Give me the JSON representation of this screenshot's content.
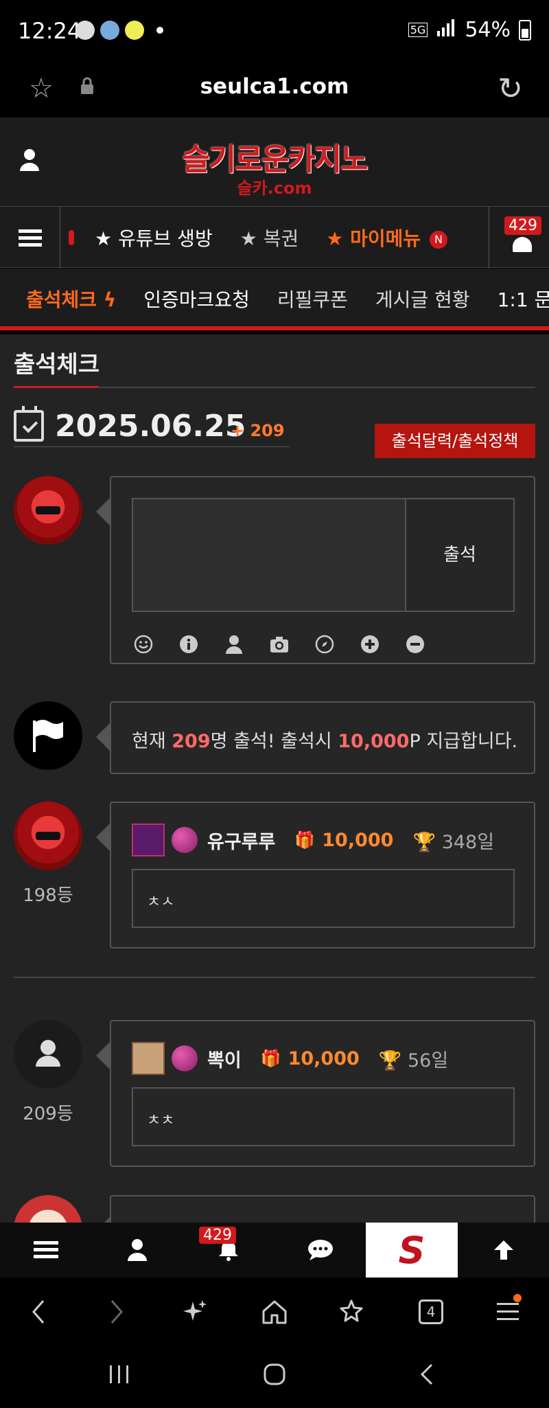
{
  "status_bar": {
    "time": "12:24",
    "network": "5G",
    "battery": "54%"
  },
  "url_bar": {
    "url": "seulca1.com"
  },
  "site": {
    "logo_main": "슬기로운카지노",
    "logo_sub": "슬카.com"
  },
  "nav": {
    "items": [
      {
        "label": "★ 유튜브 생방"
      },
      {
        "label": "★ 복권"
      },
      {
        "label": "★ 마이메뉴"
      }
    ],
    "new_badge": "N",
    "notification_count": "429"
  },
  "subtabs": {
    "items": [
      {
        "label": "출석체크 ϟ"
      },
      {
        "label": "인증마크요청"
      },
      {
        "label": "리필쿠폰"
      },
      {
        "label": "게시글 현황"
      },
      {
        "label": "1:1 문"
      }
    ]
  },
  "attendance": {
    "page_title": "출석체크",
    "date": "2025.06.25",
    "count_delta": "+ 209",
    "policy_button": "출석달력/출석정책",
    "submit_label": "출석",
    "notice": {
      "prefix": "현재 ",
      "count": "209",
      "middle": "명 출석! 출석시 ",
      "amount": "10,000",
      "suffix": "P 지급합니다."
    },
    "entries": [
      {
        "rank": "198등",
        "username": "유구루루",
        "points": "10,000",
        "days": "348일",
        "comment": "ㅊㅅ"
      },
      {
        "rank": "209등",
        "username": "뽁이",
        "points": "10,000",
        "days": "56일",
        "comment": "ㅊㅊ"
      }
    ]
  },
  "app_bar": {
    "notification_count": "429",
    "logo_letter": "S"
  },
  "browser_bar": {
    "tab_count": "4"
  },
  "colors": {
    "brand_red": "#d3191c",
    "accent_orange": "#ff6a1a",
    "highlight_pink": "#ff6a6a"
  }
}
